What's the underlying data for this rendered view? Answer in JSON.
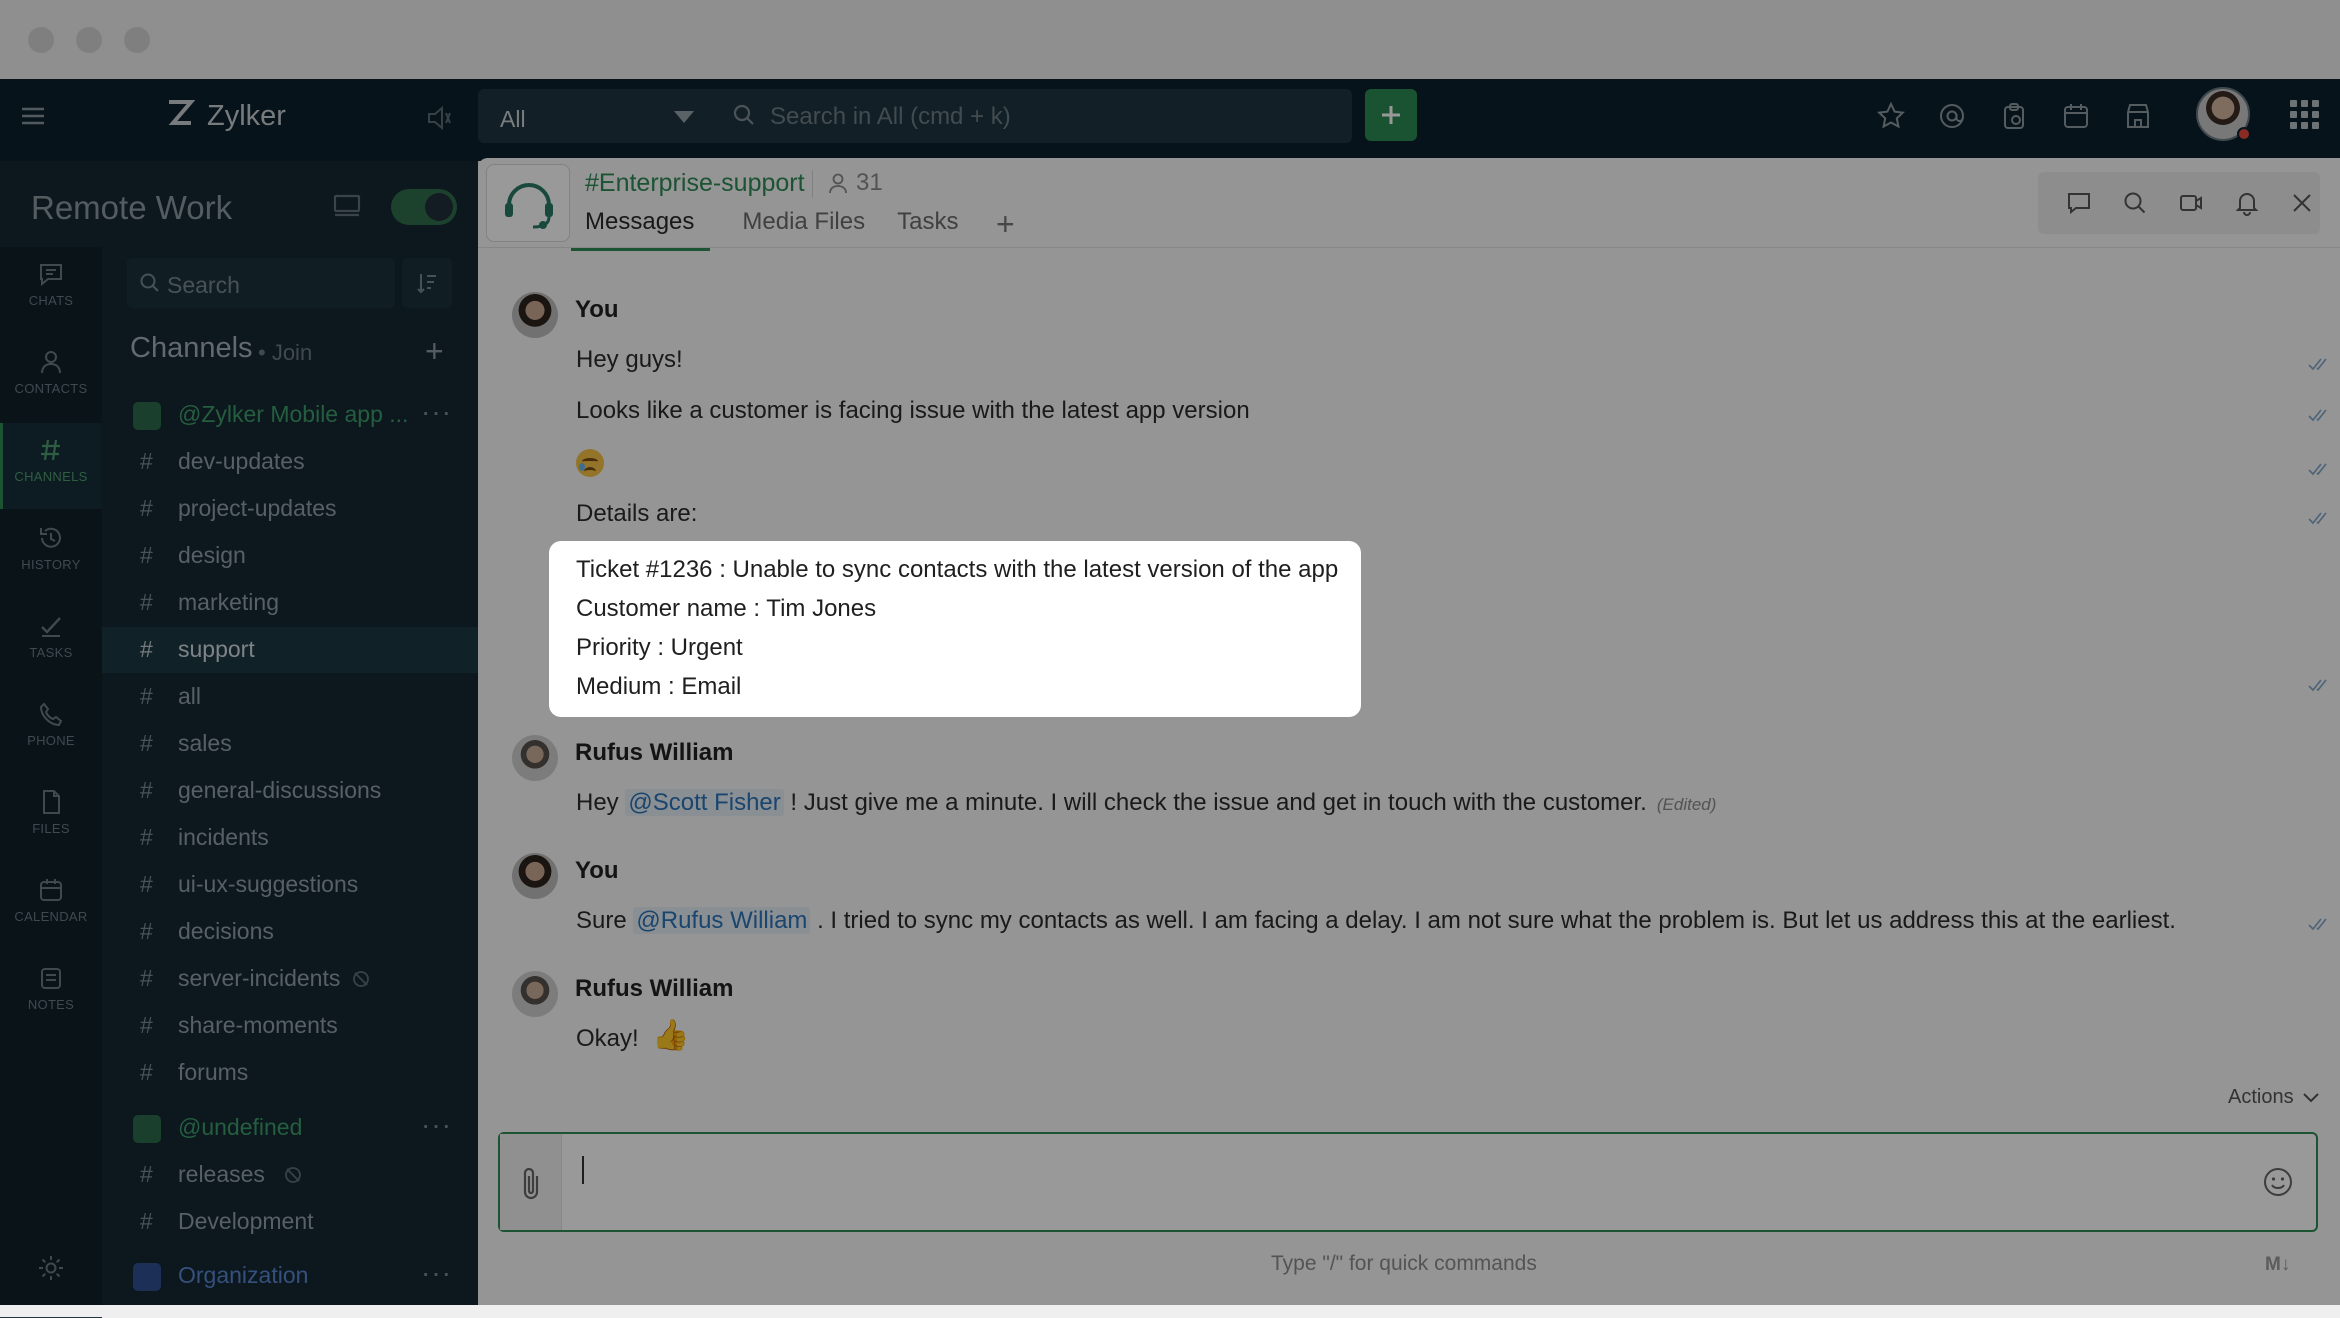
{
  "app": {
    "brand": "Zylker",
    "workspace": "Remote Work"
  },
  "topbar": {
    "scope": "All",
    "search_placeholder": "Search in All (cmd + k)",
    "icons": [
      "star-icon",
      "at-mention-icon",
      "clipboard-icon",
      "calendar-icon",
      "store-icon",
      "apps-grid-icon"
    ]
  },
  "rail": [
    {
      "label": "CHATS",
      "icon": "chat-icon"
    },
    {
      "label": "CONTACTS",
      "icon": "contact-icon"
    },
    {
      "label": "CHANNELS",
      "icon": "hash-icon",
      "active": true
    },
    {
      "label": "HISTORY",
      "icon": "history-icon"
    },
    {
      "label": "TASKS",
      "icon": "tasks-icon"
    },
    {
      "label": "PHONE",
      "icon": "phone-icon"
    },
    {
      "label": "FILES",
      "icon": "file-icon"
    },
    {
      "label": "CALENDAR",
      "icon": "calendar-icon"
    },
    {
      "label": "NOTES",
      "icon": "notes-icon"
    }
  ],
  "sidebar": {
    "search_placeholder": "Search",
    "channels_title": "Channels",
    "join": "• Join",
    "groups": [
      {
        "name": "@Zylker Mobile app ..."
      },
      {
        "name": "@undefined"
      },
      {
        "name": "Organization"
      }
    ],
    "channels": [
      "dev-updates",
      "project-updates",
      "design",
      "marketing",
      "support",
      "all",
      "sales",
      "general-discussions",
      "incidents",
      "ui-ux-suggestions",
      "decisions",
      "server-incidents",
      "share-moments",
      "forums",
      "releases",
      "Development"
    ]
  },
  "channel": {
    "name": "#Enterprise-support",
    "member_count": "31",
    "tabs": [
      "Messages",
      "Media Files",
      "Tasks"
    ]
  },
  "messages": {
    "m1": {
      "sender": "You",
      "lines": [
        "Hey guys!",
        "Looks like a customer is facing issue with the latest app version",
        "Details are:"
      ]
    },
    "details": [
      "Ticket #1236 : Unable to sync contacts with the latest version of the app",
      "Customer name : Tim Jones",
      "Priority : Urgent",
      "Medium : Email"
    ],
    "m2": {
      "sender": "Rufus William",
      "pre": "Hey ",
      "mention": "@Scott Fisher",
      "post": " ! Just give me a minute. I will check the issue and get in touch with the customer.",
      "edited": "(Edited)"
    },
    "m3": {
      "sender": "You",
      "pre": "Sure ",
      "mention": "@Rufus William",
      "post": " . I tried to sync my contacts as well. I am facing a delay. I am not sure what the problem is. But let us address this at the earliest."
    },
    "m4": {
      "sender": "Rufus William",
      "text": "Okay!"
    }
  },
  "composer": {
    "actions_label": "Actions",
    "hint": "Type \"/\" for quick commands",
    "markdown_label": "M↓"
  },
  "colors": {
    "accent": "#2e8a55",
    "topbar": "#0d212c",
    "sidebar": "#142833",
    "mention": "#2c74b8"
  }
}
